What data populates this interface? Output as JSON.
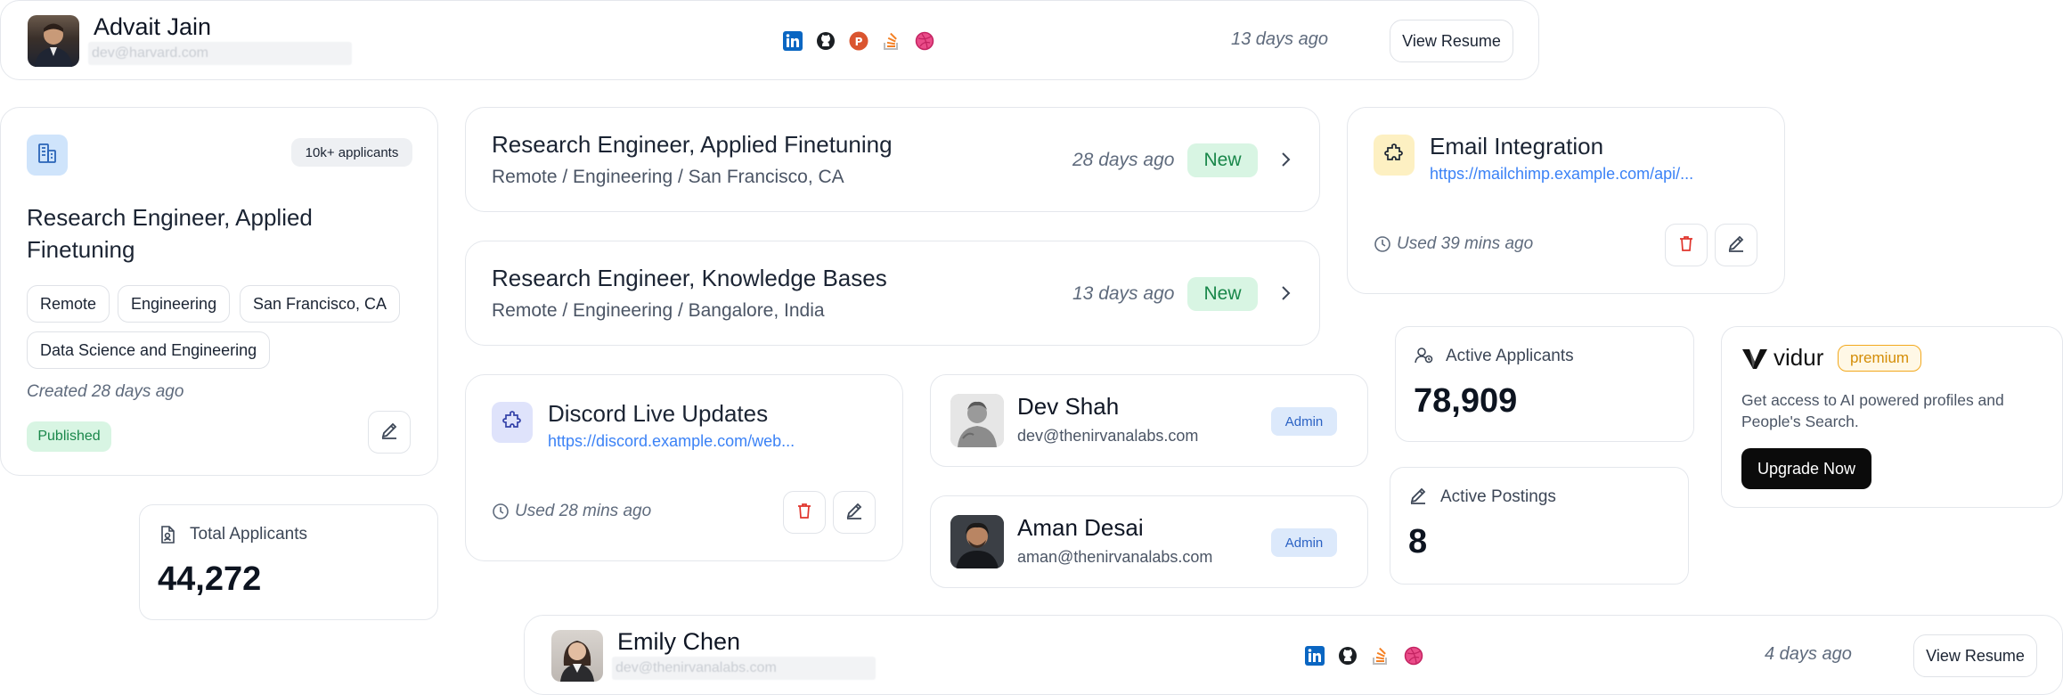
{
  "profile_top": {
    "name": "Advait Jain",
    "email": "dev@harvard.com",
    "time": "13 days ago",
    "button": "View Resume",
    "social_icons": [
      "linkedin-icon",
      "github-icon",
      "producthunt-icon",
      "stackoverflow-icon",
      "dribbble-icon"
    ]
  },
  "job_card": {
    "applicants_badge": "10k+ applicants",
    "title_line1": "Research Engineer, Applied",
    "title_line2": "Finetuning",
    "tags": [
      "Remote",
      "Engineering",
      "San Francisco, CA",
      "Data Science and Engineering"
    ],
    "created": "Created 28 days ago",
    "status": "Published"
  },
  "jobs": [
    {
      "title": "Research Engineer, Applied Finetuning",
      "location": "Remote / Engineering / San Francisco, CA",
      "time": "28 days ago",
      "badge": "New"
    },
    {
      "title": "Research Engineer, Knowledge Bases",
      "location": "Remote / Engineering / Bangalore, India",
      "time": "13 days ago",
      "badge": "New"
    }
  ],
  "integrations": {
    "email": {
      "title": "Email Integration",
      "url": "https://mailchimp.example.com/api/...",
      "used": "Used 39 mins ago"
    },
    "discord": {
      "title": "Discord Live Updates",
      "url": "https://discord.example.com/web...",
      "used": "Used 28 mins ago"
    }
  },
  "members": [
    {
      "name": "Dev Shah",
      "email": "dev@thenirvanalabs.com",
      "role": "Admin"
    },
    {
      "name": "Aman Desai",
      "email": "aman@thenirvanalabs.com",
      "role": "Admin"
    }
  ],
  "stats": {
    "total_applicants": {
      "label": "Total Applicants",
      "value": "44,272"
    },
    "active_applicants": {
      "label": "Active Applicants",
      "value": "78,909"
    },
    "active_postings": {
      "label": "Active Postings",
      "value": "8"
    }
  },
  "premium": {
    "brand": "vidur",
    "badge": "premium",
    "text_line1": "Get access to AI powered profiles and",
    "text_line2": "People's Search.",
    "button": "Upgrade Now"
  },
  "profile_bottom": {
    "name": "Emily Chen",
    "email": "dev@thenirvanalabs.com",
    "time": "4 days ago",
    "button": "View Resume",
    "social_icons": [
      "linkedin-icon",
      "github-icon",
      "stackoverflow-icon",
      "dribbble-icon"
    ]
  },
  "colors": {
    "accent_blue": "#3b82f6",
    "new_green": "#19874a",
    "delete_red": "#e0342c",
    "premium_amber": "#f2a81d"
  }
}
